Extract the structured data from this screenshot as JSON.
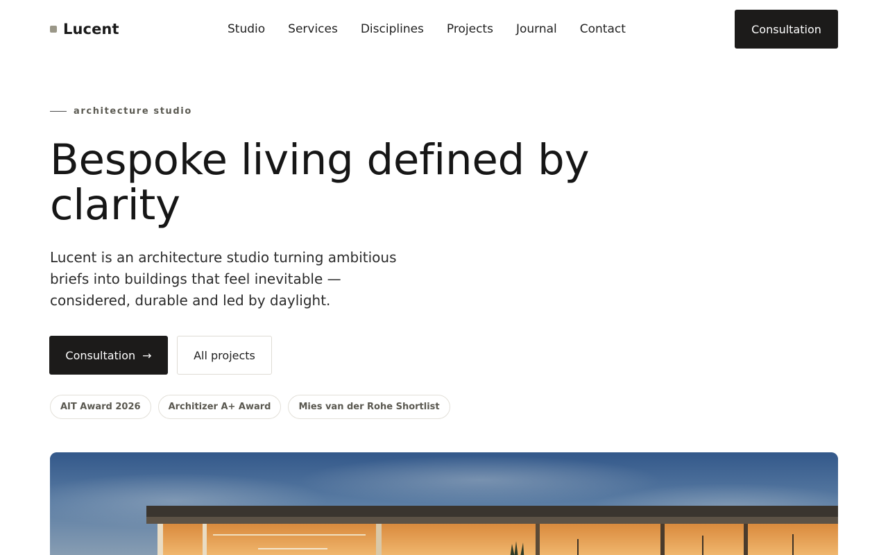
{
  "brand": {
    "name": "Lucent"
  },
  "nav": {
    "items": [
      {
        "label": "Studio"
      },
      {
        "label": "Services"
      },
      {
        "label": "Disciplines"
      },
      {
        "label": "Projects"
      },
      {
        "label": "Journal"
      },
      {
        "label": "Contact"
      }
    ],
    "cta_label": "Consultation"
  },
  "hero": {
    "eyebrow": "architecture studio",
    "title": "Bespoke living defined by clarity",
    "description": "Lucent is an architecture studio turning ambitious briefs into buildings that feel inevitable — considered, durable and led by daylight.",
    "primary_button": {
      "label": "Consultation",
      "icon": "arrow-right-icon",
      "glyph": "→"
    },
    "secondary_button": {
      "label": "All projects"
    },
    "awards": [
      "AIT Award 2026",
      "Architizer A+ Award",
      "Mies van der Rohe Shortlist"
    ]
  },
  "colors": {
    "text": "#1a1a1a",
    "dark_button": "#1c1b1a",
    "brand_mark": "#9a9788",
    "muted": "#5a5850",
    "border": "#e2dfd8",
    "sky": "#54789f",
    "warm_light": "#f1a247"
  },
  "hero_image": {
    "subject": "modern house at dusk photograph"
  }
}
